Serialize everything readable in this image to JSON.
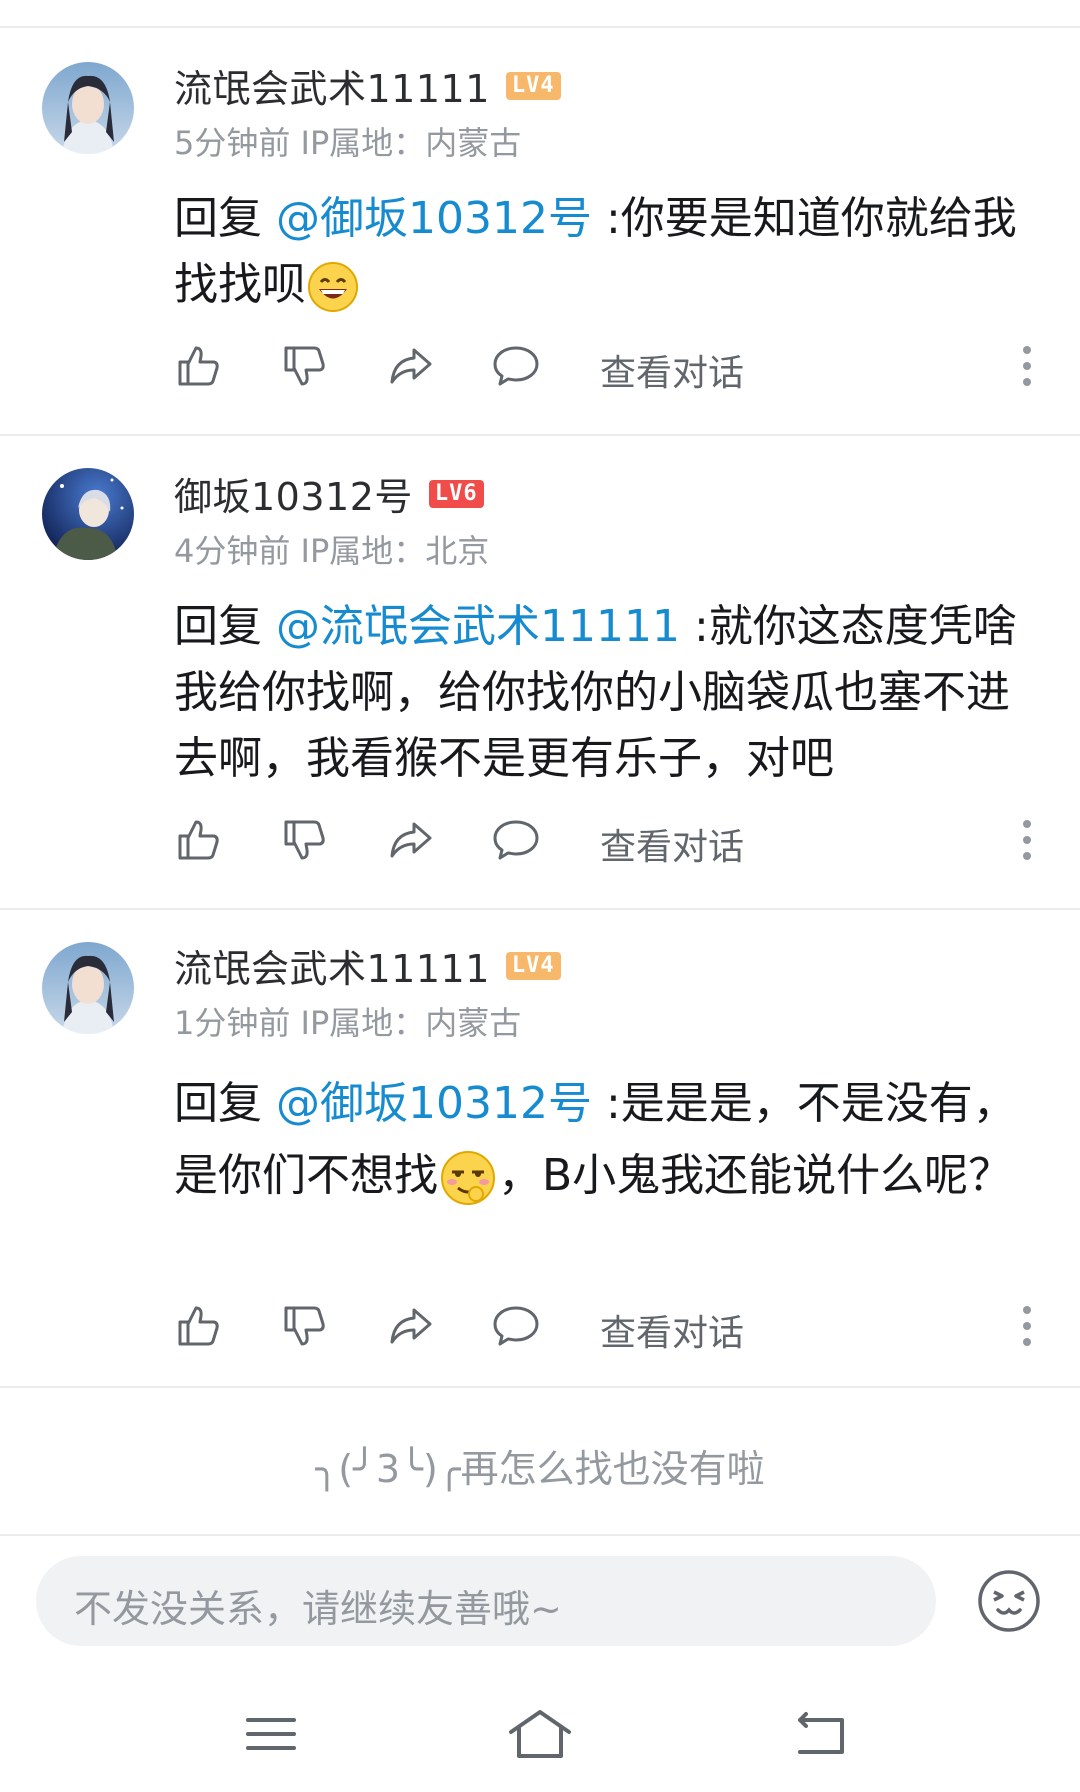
{
  "comments": [
    {
      "username": "流氓会武术11111",
      "level": "LV4",
      "level_color": "#f8b86b",
      "time": "5分钟前",
      "ip": "IP属地：内蒙古",
      "reply_prefix": "回复 ",
      "mention": "@御坂10312号",
      "text_before": " :你要是知道你就给我找找呗",
      "emoji": "grinning-face",
      "text_after": "",
      "view_conversation": "查看对话"
    },
    {
      "username": "御坂10312号",
      "level": "LV6",
      "level_color": "#f04c49",
      "time": "4分钟前",
      "ip": "IP属地：北京",
      "reply_prefix": "回复 ",
      "mention": "@流氓会武术11111",
      "text_before": " :就你这态度凭啥我给你找啊，给你找你的小脑袋瓜也塞不进去啊，我看猴不是更有乐子，对吧",
      "emoji": "",
      "text_after": "",
      "view_conversation": "查看对话"
    },
    {
      "username": "流氓会武术11111",
      "level": "LV4",
      "level_color": "#f8b86b",
      "time": "1分钟前",
      "ip": "IP属地：内蒙古",
      "reply_prefix": "回复 ",
      "mention": "@御坂10312号",
      "text_before": " :是是是，不是没有，是你们不想找",
      "emoji": "smirk-face",
      "text_after": "，B小鬼我还能说什么呢？",
      "view_conversation": "查看对话"
    }
  ],
  "end_message": "╮(╯3╰)╭再怎么找也没有啦",
  "input": {
    "placeholder": "不发没关系，请继续友善哦~"
  },
  "icons": [
    "thumb-up-icon",
    "thumb-down-icon",
    "share-icon",
    "comment-icon",
    "more-icon",
    "emoji-icon",
    "menu-icon",
    "home-icon",
    "back-icon"
  ]
}
